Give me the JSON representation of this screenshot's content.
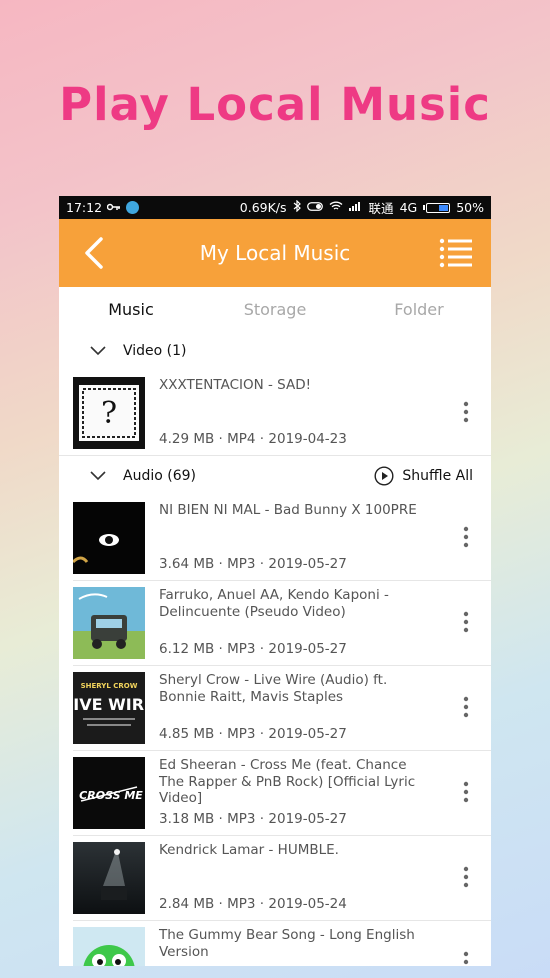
{
  "promo": {
    "title": "Play Local Music"
  },
  "status_bar": {
    "time": "17:12",
    "speed": "0.69K/s",
    "carrier": "联通",
    "network": "4G",
    "battery": "50%",
    "battery_level": 0.5
  },
  "app_bar": {
    "title": "My Local Music"
  },
  "tabs": [
    {
      "label": "Music",
      "active": true
    },
    {
      "label": "Storage",
      "active": false
    },
    {
      "label": "Folder",
      "active": false
    }
  ],
  "video_section": {
    "header": "Video (1)",
    "items": [
      {
        "title": "XXXTENTACION - SAD!",
        "meta": "4.29 MB · MP4 · 2019-04-23",
        "thumb": "question-mark"
      }
    ]
  },
  "audio_section": {
    "header": "Audio (69)",
    "shuffle_label": "Shuffle All",
    "items": [
      {
        "title": "NI BIEN NI MAL - Bad Bunny  X 100PRE",
        "meta": "3.64 MB · MP3 · 2019-05-27",
        "thumb": "eye"
      },
      {
        "title": "Farruko, Anuel AA, Kendo Kaponi - Delincuente (Pseudo Video)",
        "meta": "6.12 MB · MP3 · 2019-05-27",
        "thumb": "jeep"
      },
      {
        "title": "Sheryl Crow - Live Wire (Audio) ft. Bonnie Raitt, Mavis Staples",
        "meta": "4.85 MB · MP3 · 2019-05-27",
        "thumb": "live-wire"
      },
      {
        "title": "Ed Sheeran - Cross Me (feat. Chance The Rapper & PnB Rock) [Official Lyric Video]",
        "meta": "3.18 MB · MP3 · 2019-05-27",
        "thumb": "cross-me"
      },
      {
        "title": "Kendrick Lamar - HUMBLE.",
        "meta": "2.84 MB · MP3 · 2019-05-24",
        "thumb": "humble"
      },
      {
        "title": "The Gummy Bear Song - Long English Version",
        "meta": "",
        "thumb": "gummy"
      }
    ]
  },
  "thumb_text": {
    "live_wire_artist": "SHERYL CROW",
    "live_wire_title": "LIVE WIRE",
    "cross_me": "CROSS ME"
  },
  "colors": {
    "accent": "#f7a13a",
    "promo_title": "#ee3a84",
    "status_bar": "#0b0b0b"
  }
}
